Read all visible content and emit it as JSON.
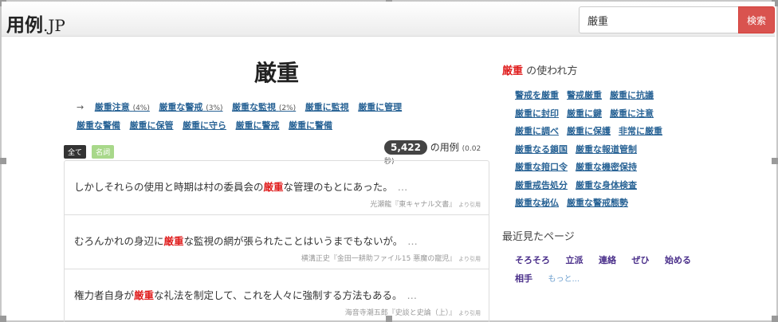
{
  "header": {
    "logo_main": "用例",
    "logo_tld": ".JP",
    "search_value": "厳重",
    "search_button": "検索"
  },
  "main": {
    "title": "厳重",
    "arrow": "→",
    "related_line1": [
      {
        "label": "厳重注意",
        "pct": "(4%)"
      },
      {
        "label": "厳重な警戒",
        "pct": "(3%)"
      },
      {
        "label": "厳重な監視",
        "pct": "(2%)"
      },
      {
        "label": "厳重に監視",
        "pct": ""
      },
      {
        "label": "厳重に管理",
        "pct": ""
      }
    ],
    "related_line2": [
      "厳重な警備",
      "厳重に保管",
      "厳重に守ら",
      "厳重に警戒",
      "厳重に警備"
    ],
    "filters": {
      "all": "全て",
      "noun": "名詞"
    },
    "count": "5,422",
    "count_suffix": "の用例",
    "time": "(0.02 秒)",
    "results": [
      {
        "before": "しかしそれらの使用と時期は村の委員会の",
        "highlight": "厳重",
        "after": "な管理のもとにあった。",
        "ellipsis": "…",
        "source": "光瀬龍『東キャナル文書』",
        "quote": "より引用"
      },
      {
        "before": "むろんかれの身辺に",
        "highlight": "厳重",
        "after": "な監視の網が張られたことはいうまでもないが。",
        "ellipsis": "…",
        "source": "横溝正史『金田一耕助ファイル15 悪魔の寵児』",
        "quote": "より引用"
      },
      {
        "before": "権力者自身が",
        "highlight": "厳重",
        "after": "な礼法を制定して、これを人々に強制する方法もある。",
        "ellipsis": "…",
        "source": "海音寺潮五郎『史談と史論（上）』",
        "quote": "より引用"
      }
    ]
  },
  "sidebar": {
    "usage_title_hl": "厳重",
    "usage_title_rest": " の使われ方",
    "usage_rows": [
      [
        "警戒を厳重",
        "警戒厳重",
        "厳重に抗議"
      ],
      [
        "厳重に封印",
        "厳重に鍵",
        "厳重に注意"
      ],
      [
        "厳重に調べ",
        "厳重に保護",
        "非常に厳重"
      ],
      [
        "厳重なる鎖国",
        "厳重な報道管制"
      ],
      [
        "厳重な箝口令",
        "厳重な機密保持"
      ],
      [
        "厳重戒告処分",
        "厳重な身体検査"
      ],
      [
        "厳重な秘仏",
        "厳重な警戒態勢"
      ]
    ],
    "recent_title": "最近見たページ",
    "recent_items": [
      "そろそろ",
      "立派",
      "連絡",
      "ぜひ",
      "始める",
      "相手"
    ],
    "recent_more": "もっと..."
  }
}
